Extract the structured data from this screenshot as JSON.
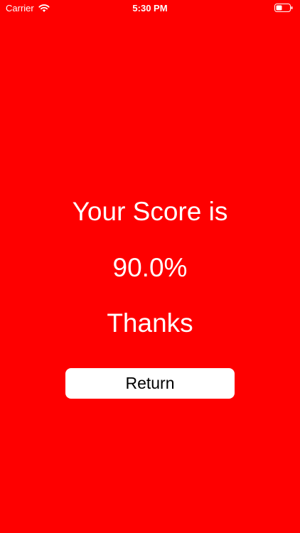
{
  "status_bar": {
    "carrier": "Carrier",
    "time": "5:30 PM",
    "icons": [
      "wifi-icon",
      "battery-icon"
    ]
  },
  "main": {
    "score_title": "Your Score is",
    "score_value": "90.0%",
    "thanks": "Thanks",
    "return_label": "Return"
  },
  "colors": {
    "background": "#fe0000",
    "text": "#ffffff",
    "button_background": "#ffffff",
    "button_text": "#000000"
  }
}
